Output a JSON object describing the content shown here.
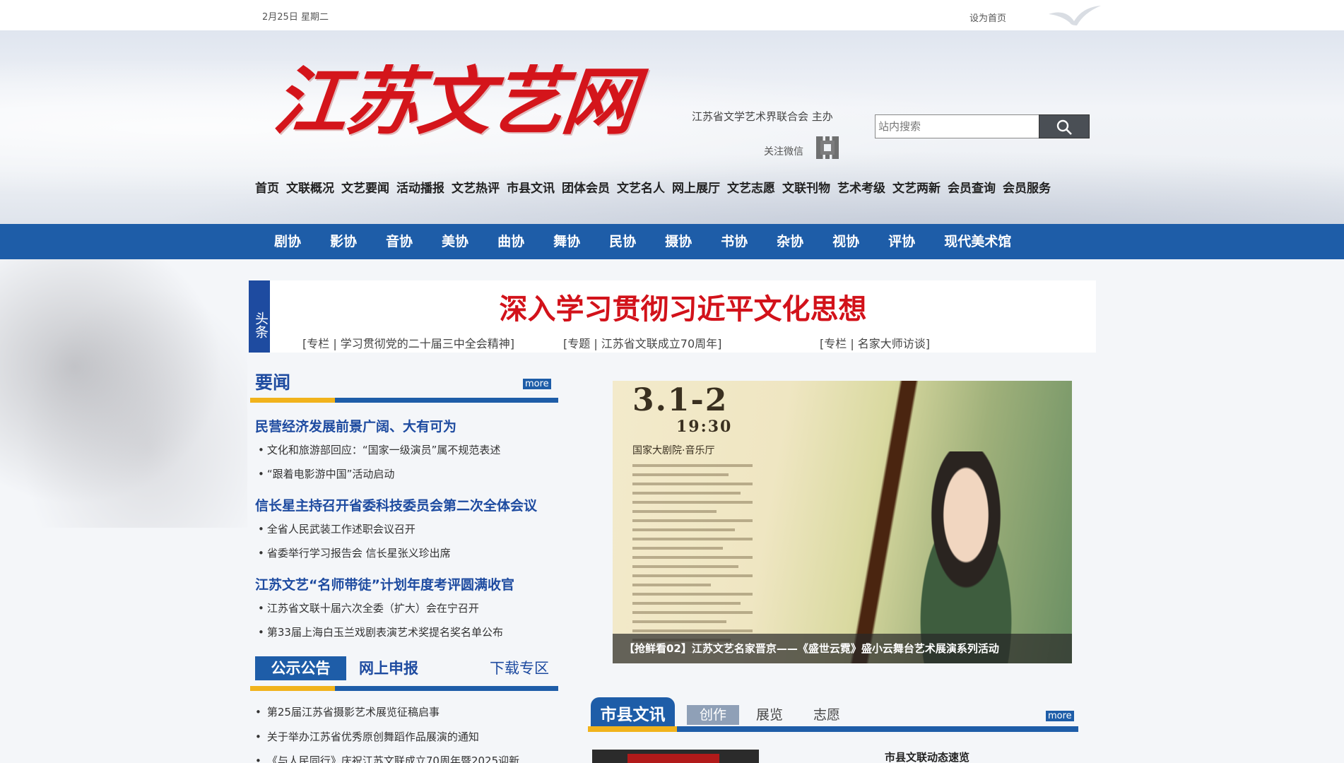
{
  "topbar": {
    "date": "2月25日 星期二",
    "set_home": "设为首页"
  },
  "header": {
    "logo_text": "江苏文艺网",
    "host": "江苏省文学艺术界联合会 主办",
    "wechat": "关注微信",
    "search_placeholder": "站内搜索",
    "nav": [
      "首页",
      "文联概况",
      "文艺要闻",
      "活动播报",
      "文艺热评",
      "市县文讯",
      "团体会员",
      "文艺名人",
      "网上展厅",
      "文艺志愿",
      "文联刊物",
      "艺术考级",
      "文艺两新",
      "会员查询",
      "会员服务"
    ]
  },
  "bluenav": [
    "剧协",
    "影协",
    "音协",
    "美协",
    "曲协",
    "舞协",
    "民协",
    "摄协",
    "书协",
    "杂协",
    "视协",
    "评协",
    "现代美术馆"
  ],
  "headline": {
    "tag": "头条",
    "title": "深入学习贯彻习近平文化思想",
    "links": [
      "[专栏 | 学习贯彻党的二十届三中全会精神]",
      "[专题 | 江苏省文联成立70周年]",
      "[专栏 | 名家大师访谈]"
    ]
  },
  "news": {
    "title": "要闻",
    "more": "more",
    "groups": [
      {
        "headline": "民营经济发展前景广阔、大有可为",
        "items": [
          "文化和旅游部回应：“国家一级演员”属不规范表述",
          "“跟着电影游中国”活动启动"
        ]
      },
      {
        "headline": "信长星主持召开省委科技委员会第二次全体会议",
        "items": [
          "全省人民武装工作述职会议召开",
          "省委举行学习报告会 信长星张义珍出席"
        ]
      },
      {
        "headline": "江苏文艺“名师带徒”计划年度考评圆满收官",
        "items": [
          "江苏省文联十届六次全委（扩大）会在宁召开",
          "第33届上海白玉兰戏剧表演艺术奖提名奖名单公布"
        ]
      }
    ]
  },
  "notices": {
    "tabs": [
      "公示公告",
      "网上申报",
      "下载专区"
    ],
    "items": [
      "第25届江苏省摄影艺术展览征稿启事",
      "关于举办江苏省优秀原创舞蹈作品展演的通知",
      "《与人民同行》庆祝江苏文联成立70周年暨2025迎新"
    ]
  },
  "poster": {
    "date": "3.1-2",
    "time": "19:30",
    "venue": "国家大剧院·音乐厅",
    "caption": "【抢鲜看02】江苏文艺名家晋京——《盛世云霓》盛小云舞台艺术展演系列活动"
  },
  "city": {
    "title": "市县文讯",
    "tabs": [
      "创作",
      "展览",
      "志愿"
    ],
    "more": "more",
    "first_item": "市县文联动态速览"
  },
  "colors": {
    "brand_blue": "#1e5da8",
    "headline_red": "#d2121a",
    "accent_yellow": "#f1b31c"
  }
}
